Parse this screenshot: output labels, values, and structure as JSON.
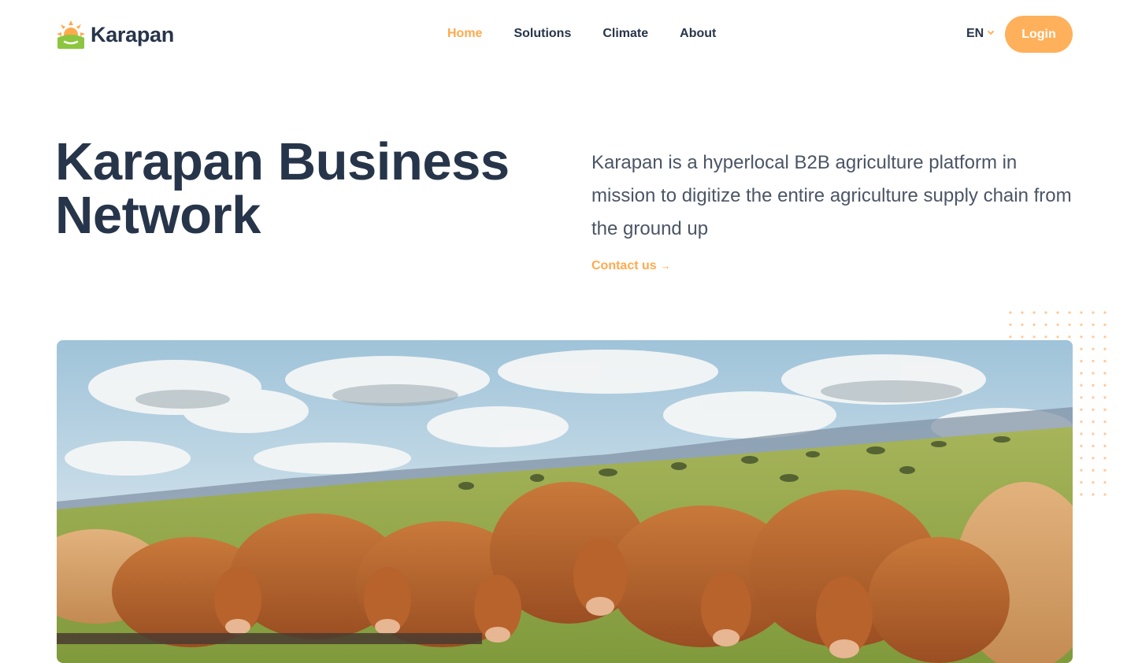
{
  "header": {
    "logo_text": "Karapan",
    "nav": [
      {
        "label": "Home",
        "active": true
      },
      {
        "label": "Solutions",
        "active": false
      },
      {
        "label": "Climate",
        "active": false
      },
      {
        "label": "About",
        "active": false
      }
    ],
    "language": "EN",
    "login_label": "Login"
  },
  "hero": {
    "title": "Karapan Business Network",
    "description": "Karapan is a hyperlocal B2B agriculture platform in mission to digitize the entire agriculture supply chain from the ground up",
    "contact_label": "Contact us",
    "contact_arrow": "→"
  },
  "icons": {
    "logo": "sun-over-field-logo-icon",
    "language_chevron": "chevron-down-icon",
    "contact_arrow": "arrow-right-icon",
    "decoration": "dot-grid-pattern"
  },
  "colors": {
    "accent": "#ffa94d",
    "login_button": "#ffb05a",
    "heading_text": "#27354a",
    "body_text": "#4b5566",
    "logo_green": "#8cc63f"
  }
}
